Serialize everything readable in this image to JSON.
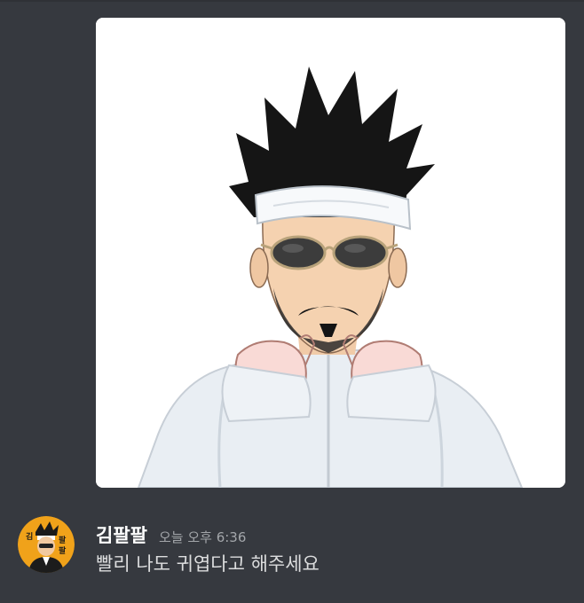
{
  "message": {
    "author": "김팔팔",
    "timestamp": "오늘 오후 6:36",
    "content": "빨리 나도 귀엽다고 해주세요",
    "attachment": {
      "type": "image",
      "subject": "anime-style character with spiky black hair, white headband, aviator sunglasses, moustache and white hoodie raising both fists"
    },
    "avatar": {
      "logo_text": "김팔팔"
    }
  },
  "colors": {
    "background": "#36393f",
    "username": "#ffffff",
    "timestamp": "#a3a6aa",
    "message_text": "#dcddde",
    "avatar_bg": "#f0a21a"
  }
}
